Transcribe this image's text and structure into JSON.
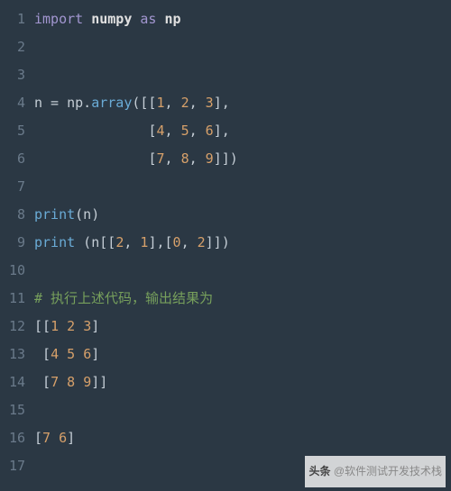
{
  "lines": [
    {
      "n": "1",
      "t": [
        [
          "kw",
          "import"
        ],
        [
          "sp",
          " "
        ],
        [
          "mod",
          "numpy"
        ],
        [
          "sp",
          " "
        ],
        [
          "kw",
          "as"
        ],
        [
          "sp",
          " "
        ],
        [
          "mod",
          "np"
        ]
      ]
    },
    {
      "n": "2",
      "t": []
    },
    {
      "n": "3",
      "t": []
    },
    {
      "n": "4",
      "t": [
        [
          "punc",
          "n = np."
        ],
        [
          "fn",
          "array"
        ],
        [
          "punc",
          "([["
        ],
        [
          "num",
          "1"
        ],
        [
          "punc",
          ", "
        ],
        [
          "num",
          "2"
        ],
        [
          "punc",
          ", "
        ],
        [
          "num",
          "3"
        ],
        [
          "punc",
          "],"
        ]
      ]
    },
    {
      "n": "5",
      "t": [
        [
          "sp",
          "              "
        ],
        [
          "punc",
          "["
        ],
        [
          "num",
          "4"
        ],
        [
          "punc",
          ", "
        ],
        [
          "num",
          "5"
        ],
        [
          "punc",
          ", "
        ],
        [
          "num",
          "6"
        ],
        [
          "punc",
          "],"
        ]
      ]
    },
    {
      "n": "6",
      "t": [
        [
          "sp",
          "              "
        ],
        [
          "punc",
          "["
        ],
        [
          "num",
          "7"
        ],
        [
          "punc",
          ", "
        ],
        [
          "num",
          "8"
        ],
        [
          "punc",
          ", "
        ],
        [
          "num",
          "9"
        ],
        [
          "punc",
          "]])"
        ]
      ]
    },
    {
      "n": "7",
      "t": []
    },
    {
      "n": "8",
      "t": [
        [
          "fn",
          "print"
        ],
        [
          "punc",
          "(n)"
        ]
      ]
    },
    {
      "n": "9",
      "t": [
        [
          "fn",
          "print"
        ],
        [
          "punc",
          " (n[["
        ],
        [
          "num",
          "2"
        ],
        [
          "punc",
          ", "
        ],
        [
          "num",
          "1"
        ],
        [
          "punc",
          "],["
        ],
        [
          "num",
          "0"
        ],
        [
          "punc",
          ", "
        ],
        [
          "num",
          "2"
        ],
        [
          "punc",
          "]])"
        ]
      ]
    },
    {
      "n": "10",
      "t": []
    },
    {
      "n": "11",
      "t": [
        [
          "cm",
          "# 执行上述代码，输出结果为"
        ]
      ]
    },
    {
      "n": "12",
      "t": [
        [
          "punc",
          "[["
        ],
        [
          "num",
          "1"
        ],
        [
          "sp",
          " "
        ],
        [
          "num",
          "2"
        ],
        [
          "sp",
          " "
        ],
        [
          "num",
          "3"
        ],
        [
          "punc",
          "]"
        ]
      ]
    },
    {
      "n": "13",
      "t": [
        [
          "sp",
          " "
        ],
        [
          "punc",
          "["
        ],
        [
          "num",
          "4"
        ],
        [
          "sp",
          " "
        ],
        [
          "num",
          "5"
        ],
        [
          "sp",
          " "
        ],
        [
          "num",
          "6"
        ],
        [
          "punc",
          "]"
        ]
      ]
    },
    {
      "n": "14",
      "t": [
        [
          "sp",
          " "
        ],
        [
          "punc",
          "["
        ],
        [
          "num",
          "7"
        ],
        [
          "sp",
          " "
        ],
        [
          "num",
          "8"
        ],
        [
          "sp",
          " "
        ],
        [
          "num",
          "9"
        ],
        [
          "punc",
          "]]"
        ]
      ]
    },
    {
      "n": "15",
      "t": []
    },
    {
      "n": "16",
      "t": [
        [
          "punc",
          "["
        ],
        [
          "num",
          "7"
        ],
        [
          "sp",
          " "
        ],
        [
          "num",
          "6"
        ],
        [
          "punc",
          "]"
        ]
      ]
    },
    {
      "n": "17",
      "t": []
    }
  ],
  "footer_brand": "头条",
  "footer_handle": "@软件测试开发技术栈"
}
